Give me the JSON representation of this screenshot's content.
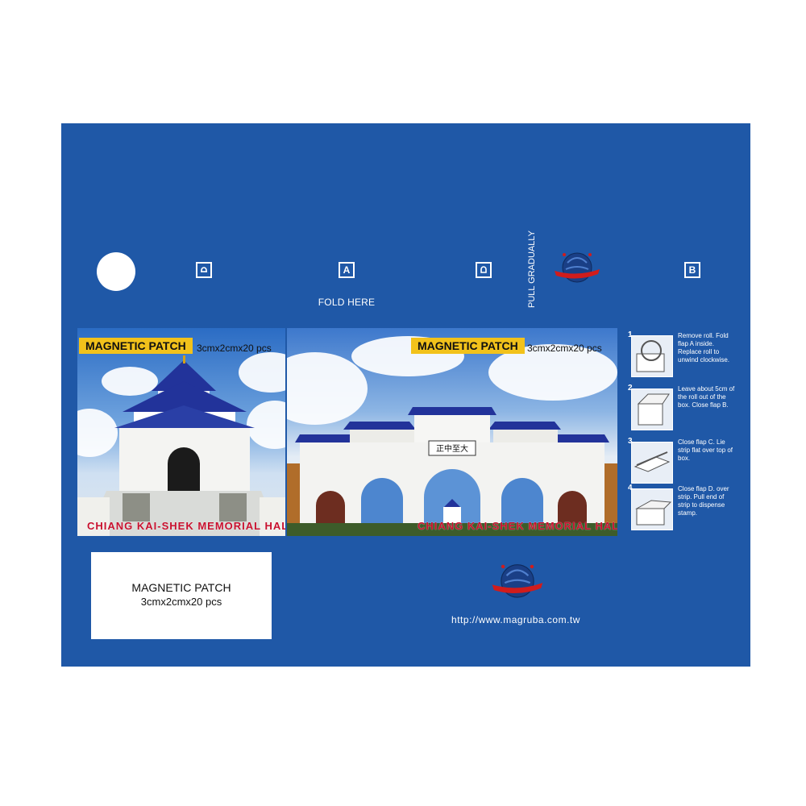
{
  "fold_here": "FOLD HERE",
  "pull_gradually": "PULL GRADUALLY",
  "flaps": {
    "c": "C",
    "a": "A",
    "d": "D",
    "b": "B"
  },
  "left_card": {
    "title": "MAGNETIC PATCH",
    "size": "3cmx2cmx20 pcs",
    "caption": "CHIANG KAI-SHEK MEMORIAL HALL"
  },
  "right_card": {
    "title": "MAGNETIC PATCH",
    "size": "3cmx2cmx20 pcs",
    "caption": "CHIANG KAI-SHEK MEMORIAL HALL",
    "gate_plaque": "正中至大"
  },
  "steps": [
    {
      "num": "1",
      "text": "Remove roll. Fold flap A inside. Replace roll to unwind clockwise."
    },
    {
      "num": "2",
      "text": "Leave about 5cm of the roll out of the box. Close flap B."
    },
    {
      "num": "3",
      "text": "Close flap C. Lie strip flat over top of box."
    },
    {
      "num": "4",
      "text": "Close flap D. over strip. Pull end of strip to dispense stamp."
    }
  ],
  "label_box": {
    "title": "MAGNETIC PATCH",
    "size": "3cmx2cmx20 pcs"
  },
  "url": "http://www.magruba.com.tw",
  "colors": {
    "panel": "#1f58a7",
    "tag": "#f2c21b",
    "caption": "#c8102e"
  }
}
